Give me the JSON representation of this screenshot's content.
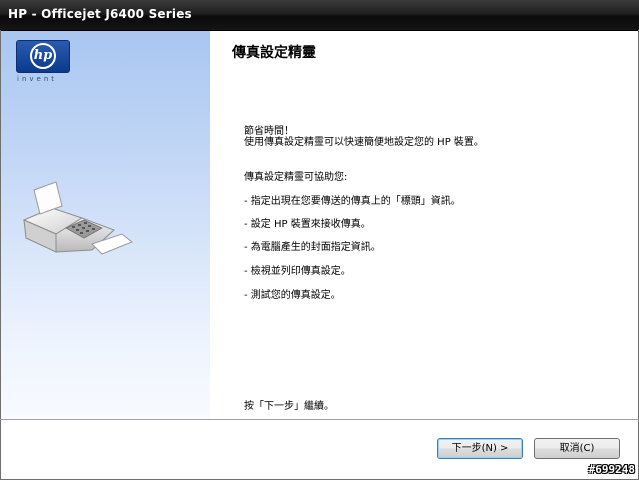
{
  "window": {
    "title": "HP - Officejet J6400 Series"
  },
  "sidebar": {
    "logo_mark": "hp",
    "logo_tagline": "invent",
    "illustration_icon": "fax-machine-icon"
  },
  "main": {
    "heading": "傳真設定精靈",
    "intro_line1": "節省時間！",
    "intro_line2": "使用傳真設定精靈可以快速簡便地設定您的 HP 裝置。",
    "helps_label": "傳真設定精靈可協助您:",
    "bullets": [
      "- 指定出現在您要傳送的傳真上的「標頭」資訊。",
      "- 設定 HP 裝置來接收傳真。",
      "- 為電腦產生的封面指定資訊。",
      "- 檢視並列印傳真設定。",
      "- 測試您的傳真設定。"
    ],
    "continue_text": "按「下一步」繼續。"
  },
  "buttons": {
    "next_label": "下一步(N) >",
    "cancel_label": "取消(C)"
  },
  "watermark": "#699248",
  "colors": {
    "titlebar": "#1f1f1f",
    "sidebar_top": "#a9c6f1",
    "hp_blue": "#0a3a8c"
  }
}
